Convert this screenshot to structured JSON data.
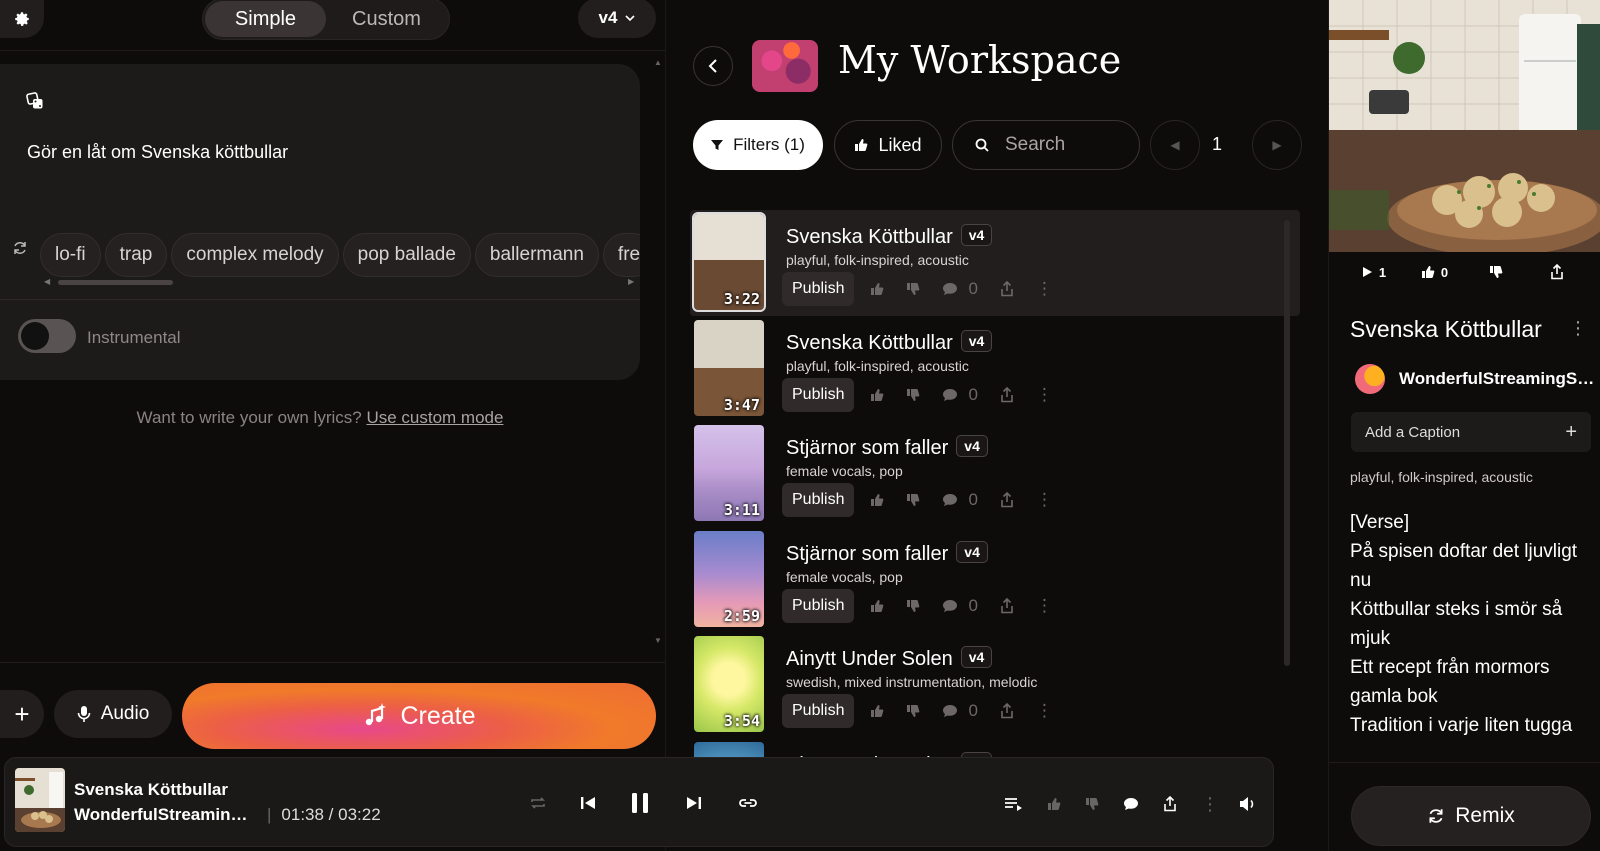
{
  "left": {
    "modes": [
      "Simple",
      "Custom"
    ],
    "active_mode": "Simple",
    "version": "v4",
    "prompt_text": "Gör en låt om Svenska köttbullar",
    "style_tags": [
      "lo-fi",
      "trap",
      "complex melody",
      "pop ballade",
      "ballermann",
      "fre"
    ],
    "instrumental_label": "Instrumental",
    "instrumental_on": false,
    "custom_hint": "Want to write your own lyrics?",
    "custom_link": "Use custom mode",
    "audio_label": "Audio",
    "create_label": "Create"
  },
  "workspace": {
    "title": "My Workspace",
    "filters_label": "Filters (1)",
    "liked_label": "Liked",
    "search_placeholder": "Search",
    "page": "1",
    "songs": [
      {
        "title": "Svenska Köttbullar",
        "version": "v4",
        "tags": "playful, folk-inspired, acoustic",
        "duration": "3:22",
        "publish": "Publish",
        "comments": "0",
        "selected": true,
        "new": false
      },
      {
        "title": "Svenska Köttbullar",
        "version": "v4",
        "tags": "playful, folk-inspired, acoustic",
        "duration": "3:47",
        "publish": "Publish",
        "comments": "0",
        "selected": false,
        "new": true
      },
      {
        "title": "Stjärnor som faller",
        "version": "v4",
        "tags": "female vocals, pop",
        "duration": "3:11",
        "publish": "Publish",
        "comments": "0",
        "selected": false,
        "new": false
      },
      {
        "title": "Stjärnor som faller",
        "version": "v4",
        "tags": "female vocals, pop",
        "duration": "2:59",
        "publish": "Publish",
        "comments": "0",
        "selected": false,
        "new": true
      },
      {
        "title": "Ainytt Under Solen",
        "version": "v4",
        "tags": "swedish, mixed instrumentation, melodic",
        "duration": "3:54",
        "publish": "Publish",
        "comments": "0",
        "selected": false,
        "new": false
      },
      {
        "title": "Ainytt Under Solen",
        "version": "v4",
        "tags": "",
        "duration": "",
        "publish": "Publish",
        "comments": "0",
        "selected": false,
        "new": false
      }
    ]
  },
  "detail": {
    "plays": "1",
    "likes": "0",
    "title": "Svenska Köttbullar",
    "artist": "WonderfulStreamingSer...",
    "caption_placeholder": "Add a Caption",
    "tags": "playful, folk-inspired, acoustic",
    "lyrics": [
      "[Verse]",
      "På spisen doftar det ljuvligt nu",
      "Köttbullar steks i smör så mjuk",
      "Ett recept från mormors gamla bok",
      "Tradition i varje liten tugga"
    ],
    "remix_label": "Remix"
  },
  "player": {
    "title": "Svenska Köttbullar",
    "artist": "WonderfulStreamingS...",
    "current_time": "01:38",
    "total_time": "03:22",
    "time_display": "01:38 / 03:22"
  }
}
